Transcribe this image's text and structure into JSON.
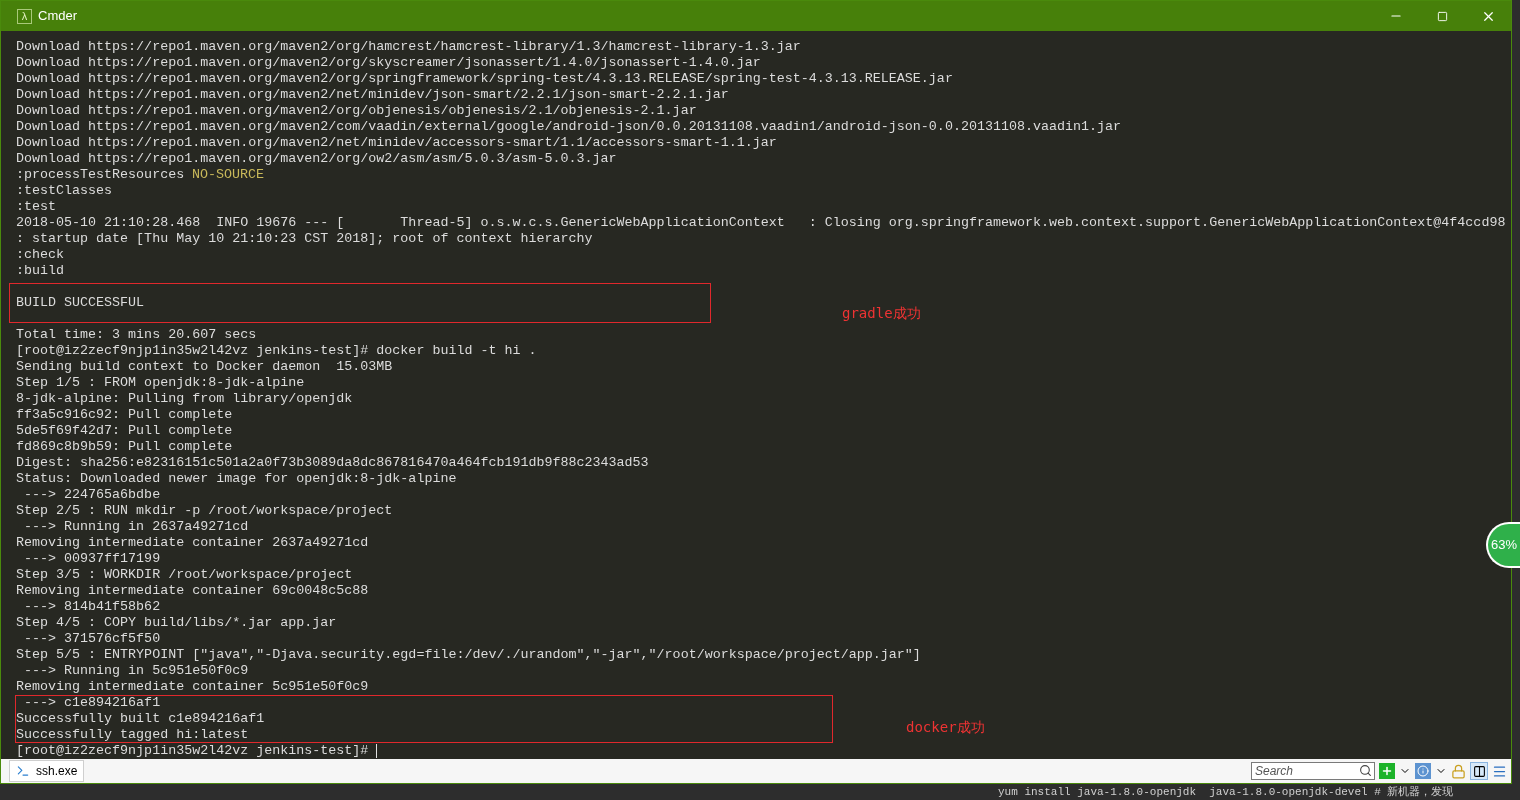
{
  "window": {
    "title": "Cmder",
    "icon": "λ"
  },
  "terminal": {
    "lines": [
      {
        "kind": "text",
        "text": "Download https://repo1.maven.org/maven2/org/hamcrest/hamcrest-library/1.3/hamcrest-library-1.3.jar"
      },
      {
        "kind": "text",
        "text": "Download https://repo1.maven.org/maven2/org/skyscreamer/jsonassert/1.4.0/jsonassert-1.4.0.jar"
      },
      {
        "kind": "text",
        "text": "Download https://repo1.maven.org/maven2/org/springframework/spring-test/4.3.13.RELEASE/spring-test-4.3.13.RELEASE.jar"
      },
      {
        "kind": "text",
        "text": "Download https://repo1.maven.org/maven2/net/minidev/json-smart/2.2.1/json-smart-2.2.1.jar"
      },
      {
        "kind": "text",
        "text": "Download https://repo1.maven.org/maven2/org/objenesis/objenesis/2.1/objenesis-2.1.jar"
      },
      {
        "kind": "text",
        "text": "Download https://repo1.maven.org/maven2/com/vaadin/external/google/android-json/0.0.20131108.vaadin1/android-json-0.0.20131108.vaadin1.jar"
      },
      {
        "kind": "text",
        "text": "Download https://repo1.maven.org/maven2/net/minidev/accessors-smart/1.1/accessors-smart-1.1.jar"
      },
      {
        "kind": "text",
        "text": "Download https://repo1.maven.org/maven2/org/ow2/asm/asm/5.0.3/asm-5.0.3.jar"
      },
      {
        "kind": "text",
        "text": ":processTestResources",
        "tag": "NO-SOURCE"
      },
      {
        "kind": "text",
        "text": ":testClasses"
      },
      {
        "kind": "text",
        "text": ":test"
      },
      {
        "kind": "text",
        "text": "2018-05-10 21:10:28.468  INFO 19676 --- [       Thread-5] o.s.w.c.s.GenericWebApplicationContext   : Closing org.springframework.web.context.support.GenericWebApplicationContext@4f4ccd98"
      },
      {
        "kind": "text",
        "text": ": startup date [Thu May 10 21:10:23 CST 2018]; root of context hierarchy"
      },
      {
        "kind": "text",
        "text": ":check"
      },
      {
        "kind": "text",
        "text": ":build"
      },
      {
        "kind": "blank"
      },
      {
        "kind": "text",
        "text": "BUILD SUCCESSFUL"
      },
      {
        "kind": "blank"
      },
      {
        "kind": "text",
        "text": "Total time: 3 mins 20.607 secs"
      },
      {
        "kind": "text",
        "text": "[root@iz2zecf9njp1in35w2l42vz jenkins-test]# docker build -t hi ."
      },
      {
        "kind": "text",
        "text": "Sending build context to Docker daemon  15.03MB"
      },
      {
        "kind": "text",
        "text": "Step 1/5 : FROM openjdk:8-jdk-alpine"
      },
      {
        "kind": "text",
        "text": "8-jdk-alpine: Pulling from library/openjdk"
      },
      {
        "kind": "text",
        "text": "ff3a5c916c92: Pull complete"
      },
      {
        "kind": "text",
        "text": "5de5f69f42d7: Pull complete"
      },
      {
        "kind": "text",
        "text": "fd869c8b9b59: Pull complete"
      },
      {
        "kind": "text",
        "text": "Digest: sha256:e82316151c501a2a0f73b3089da8dc867816470a464fcb191db9f88c2343ad53"
      },
      {
        "kind": "text",
        "text": "Status: Downloaded newer image for openjdk:8-jdk-alpine"
      },
      {
        "kind": "text",
        "text": " ---> 224765a6bdbe"
      },
      {
        "kind": "text",
        "text": "Step 2/5 : RUN mkdir -p /root/workspace/project"
      },
      {
        "kind": "text",
        "text": " ---> Running in 2637a49271cd"
      },
      {
        "kind": "text",
        "text": "Removing intermediate container 2637a49271cd"
      },
      {
        "kind": "text",
        "text": " ---> 00937ff17199"
      },
      {
        "kind": "text",
        "text": "Step 3/5 : WORKDIR /root/workspace/project"
      },
      {
        "kind": "text",
        "text": "Removing intermediate container 69c0048c5c88"
      },
      {
        "kind": "text",
        "text": " ---> 814b41f58b62"
      },
      {
        "kind": "text",
        "text": "Step 4/5 : COPY build/libs/*.jar app.jar"
      },
      {
        "kind": "text",
        "text": " ---> 371576cf5f50"
      },
      {
        "kind": "text",
        "text": "Step 5/5 : ENTRYPOINT [\"java\",\"-Djava.security.egd=file:/dev/./urandom\",\"-jar\",\"/root/workspace/project/app.jar\"]"
      },
      {
        "kind": "text",
        "text": " ---> Running in 5c951e50f0c9"
      },
      {
        "kind": "text",
        "text": "Removing intermediate container 5c951e50f0c9"
      },
      {
        "kind": "text",
        "text": " ---> c1e894216af1"
      },
      {
        "kind": "text",
        "text": "Successfully built c1e894216af1"
      },
      {
        "kind": "text",
        "text": "Successfully tagged hi:latest"
      },
      {
        "kind": "prompt",
        "text": "[root@iz2zecf9njp1in35w2l42vz jenkins-test]#"
      }
    ]
  },
  "annotations": [
    {
      "label": "gradle成功"
    },
    {
      "label": "docker成功"
    }
  ],
  "badge": {
    "text": "63%"
  },
  "status_bar": {
    "tab": "ssh.exe",
    "search": {
      "placeholder": "Search"
    }
  },
  "background_text": "yum install java-1.8.0-openjdk  java-1.8.0-openjdk-devel # 新机器，发现"
}
